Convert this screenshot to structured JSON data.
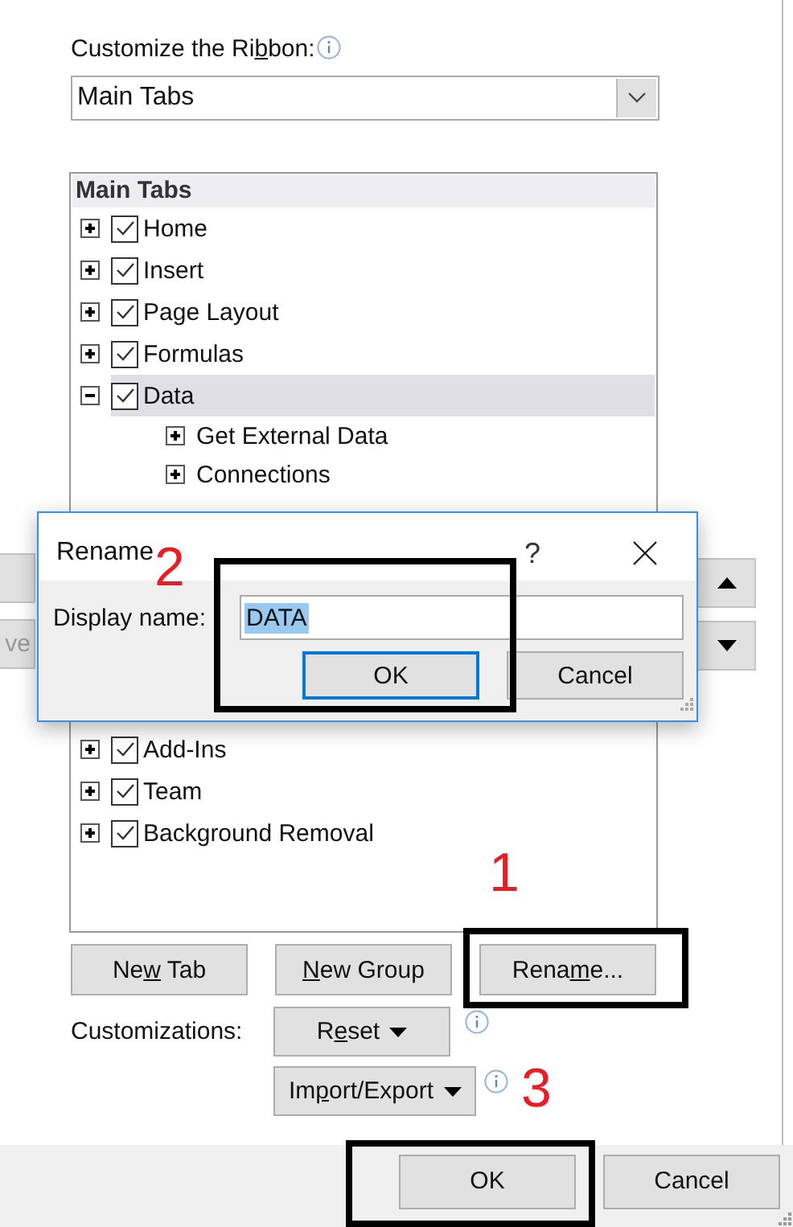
{
  "ribbon_label": {
    "before": "Customize the Ri",
    "key": "b",
    "after": "bon:"
  },
  "dropdown": {
    "value": "Main Tabs"
  },
  "left_buttons": [
    {
      "kind": "blank"
    },
    {
      "kind": "text",
      "label": "ve"
    }
  ],
  "tree": {
    "header": "Main Tabs",
    "items": [
      {
        "label": "Home",
        "checked": true,
        "expanded": false,
        "selected": false
      },
      {
        "label": "Insert",
        "checked": true,
        "expanded": false,
        "selected": false
      },
      {
        "label": "Page Layout",
        "checked": true,
        "expanded": false,
        "selected": false
      },
      {
        "label": "Formulas",
        "checked": true,
        "expanded": false,
        "selected": false
      },
      {
        "label": "Data",
        "checked": true,
        "expanded": true,
        "selected": true,
        "children": [
          {
            "label": "Get External Data",
            "expanded": false
          },
          {
            "label": "Connections",
            "expanded": false
          }
        ]
      }
    ],
    "items_below": [
      {
        "label": "Add-Ins",
        "checked": true,
        "expanded": false,
        "selected": false
      },
      {
        "label": "Team",
        "checked": true,
        "expanded": false,
        "selected": false
      },
      {
        "label": "Background Removal",
        "checked": true,
        "expanded": false,
        "selected": false
      }
    ]
  },
  "right_buttons": [
    {
      "kind": "up"
    },
    {
      "kind": "down"
    }
  ],
  "tree_buttons": [
    {
      "before": "Ne",
      "key": "w",
      "after": " Tab"
    },
    {
      "key": "N",
      "after": "ew Group"
    },
    {
      "before": "Rena",
      "key": "m",
      "after": "e..."
    }
  ],
  "customizations": {
    "label": "Customizations:",
    "reset": {
      "before": "R",
      "key": "e",
      "after": "set"
    },
    "import_export": {
      "before": "Im",
      "key": "p",
      "after": "ort/Export"
    }
  },
  "footer_buttons": [
    {
      "label": "OK"
    },
    {
      "label": "Cancel"
    }
  ],
  "dialog": {
    "title": "Rename",
    "help": "?",
    "field_label": "Display name:",
    "value": "DATA",
    "value_selected": true,
    "buttons": [
      {
        "label": "OK",
        "default": true
      },
      {
        "label": "Cancel",
        "default": false
      }
    ]
  },
  "callouts": [
    {
      "label": "1"
    },
    {
      "label": "2"
    },
    {
      "label": "3"
    }
  ]
}
